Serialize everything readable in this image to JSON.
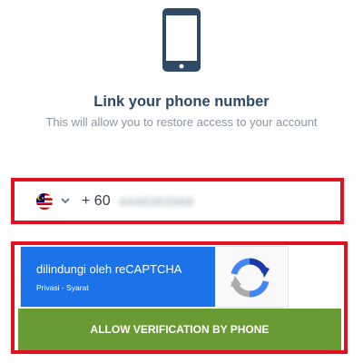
{
  "header": {
    "icon": "smartphone-icon",
    "title": "Link your phone number",
    "subtitle": "This will allow you to restore access to your account"
  },
  "phone_input": {
    "country_flag": "malaysia-flag-icon",
    "dropdown_icon": "chevron-down-icon",
    "country_code": "+ 60",
    "value": "4446363968"
  },
  "recaptcha": {
    "title": "dilindungi oleh reCAPTCHA",
    "links": "Privasi - Syarat",
    "logo": "recaptcha-logo-icon"
  },
  "allow_button": {
    "label": "ALLOW VERIFICATION BY PHONE"
  },
  "colors": {
    "title": "#2c4a67",
    "subtitle": "#8a96a3",
    "highlight_border": "#e3111d",
    "recaptcha_blue": "#1a73e8",
    "button_green": "#6a9a34",
    "icon_blue": "#2f4a66"
  }
}
